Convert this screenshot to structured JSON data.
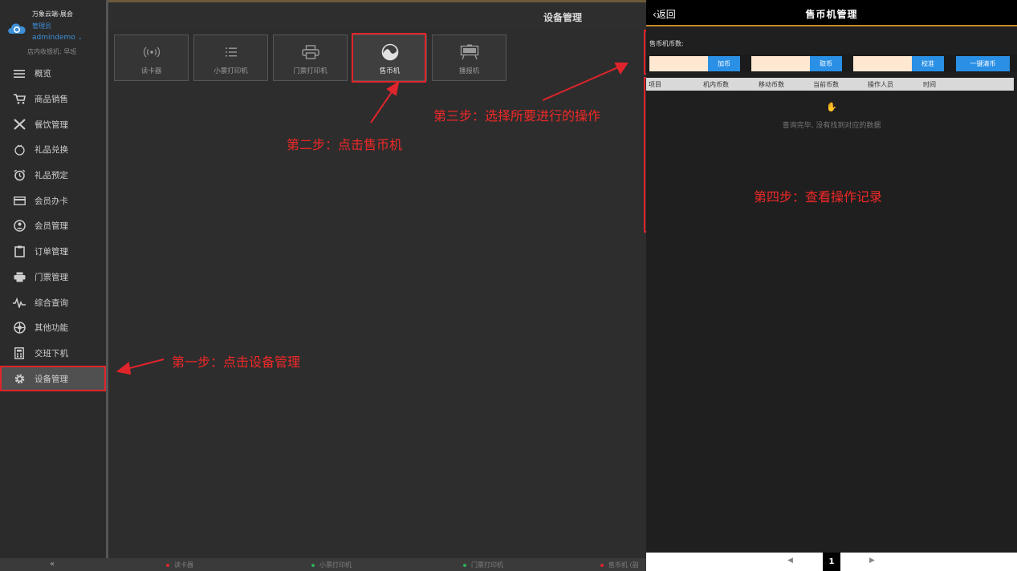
{
  "brand": {
    "name": "万象云端-展会",
    "role": "管理员",
    "user": "admindemo",
    "caret": "⌄",
    "shift": "店内收银机: 早班"
  },
  "menu": [
    {
      "label": "概览",
      "icon": "list-icon"
    },
    {
      "label": "商品销售",
      "icon": "cart-icon"
    },
    {
      "label": "餐饮管理",
      "icon": "utensils-icon"
    },
    {
      "label": "礼品兑换",
      "icon": "gift-icon"
    },
    {
      "label": "礼品预定",
      "icon": "alarm-clock-icon"
    },
    {
      "label": "会员办卡",
      "icon": "card-icon"
    },
    {
      "label": "会员管理",
      "icon": "member-icon"
    },
    {
      "label": "订单管理",
      "icon": "clipboard-icon"
    },
    {
      "label": "门票管理",
      "icon": "ticket-printer-icon"
    },
    {
      "label": "综合查询",
      "icon": "pulse-icon"
    },
    {
      "label": "其他功能",
      "icon": "aperture-icon"
    },
    {
      "label": "交班下机",
      "icon": "calculator-icon"
    },
    {
      "label": "设备管理",
      "icon": "gear-icon",
      "active": true
    }
  ],
  "main": {
    "title": "设备管理",
    "devices": [
      {
        "label": "读卡器",
        "icon": "card-reader-icon"
      },
      {
        "label": "小票打印机",
        "icon": "list-printer-icon"
      },
      {
        "label": "门票打印机",
        "icon": "printer-icon"
      },
      {
        "label": "售币机",
        "icon": "coin-machine-icon",
        "active": true
      },
      {
        "label": "播报机",
        "icon": "screen-icon"
      }
    ]
  },
  "annotations": {
    "step1": "第一步：点击设备管理",
    "step2": "第二步：点击售币机",
    "step3": "第三步：选择所要进行的操作",
    "step4": "第四步：查看操作记录"
  },
  "status_bar": {
    "collapse": "«",
    "items": [
      {
        "label": "读卡器",
        "color": "#e0242b"
      },
      {
        "label": "小票打印机",
        "color": "#2fae5a"
      },
      {
        "label": "门票打印机",
        "color": "#2fae5a"
      },
      {
        "label": "售币机 (副",
        "color": "#e0242b"
      }
    ]
  },
  "panel": {
    "back": "‹返回",
    "title": "售币机管理",
    "coin_label": "售币机币数:",
    "buttons": {
      "add": "加币",
      "take": "取币",
      "calibrate": "校准",
      "clear": "一键清币"
    },
    "inputs": {
      "add": "",
      "take": "",
      "calibrate": ""
    },
    "table": {
      "columns": [
        "项目",
        "机内币数",
        "移动币数",
        "当前币数",
        "操作人员",
        "时间"
      ],
      "rows": []
    },
    "empty_text": "查询完毕, 没有找到对应的数据",
    "pager": {
      "prev": "◀",
      "current": "1",
      "next": "▶"
    }
  },
  "colors": {
    "accent": "#2a90e6",
    "annotation": "#e0242b",
    "input_bg": "#ffe8d2"
  }
}
